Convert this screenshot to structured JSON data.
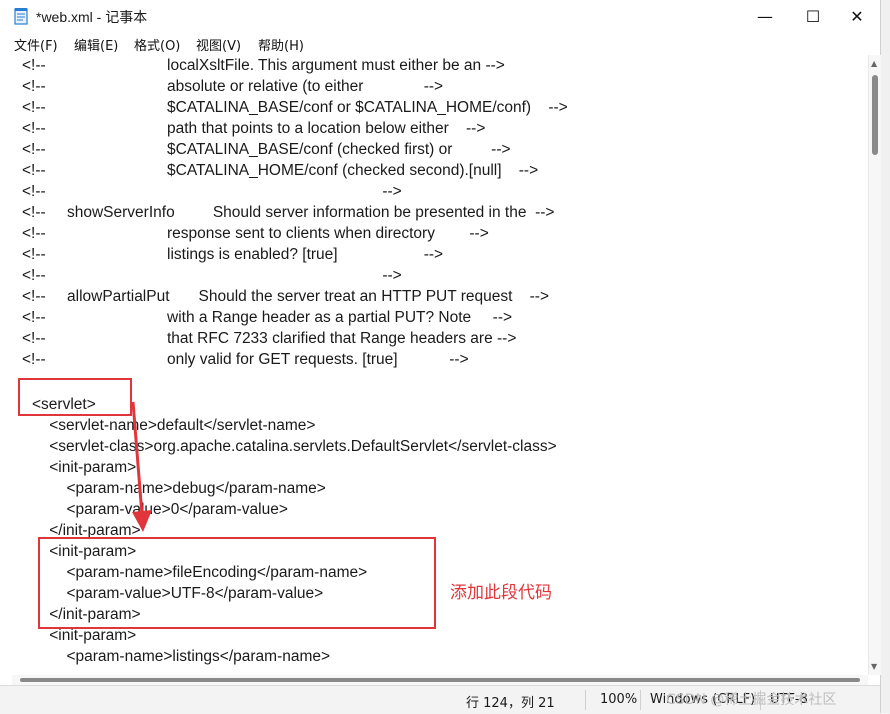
{
  "window": {
    "title": "*web.xml - 记事本",
    "controls": {
      "minimize": "—",
      "maximize": "☐",
      "close": "✕"
    }
  },
  "menu": [
    {
      "label": "文件(F)"
    },
    {
      "label": "编辑(E)"
    },
    {
      "label": "格式(O)"
    },
    {
      "label": "视图(V)"
    },
    {
      "label": "帮助(H)"
    }
  ],
  "editor": {
    "lines": [
      {
        "a": "<!--",
        "b": "",
        "c": "localXsltFile. This argument must either be an -->"
      },
      {
        "a": "<!--",
        "b": "",
        "c": "absolute or relative (to either              -->"
      },
      {
        "a": "<!--",
        "b": "",
        "c": "$CATALINA_BASE/conf or $CATALINA_HOME/conf)    -->"
      },
      {
        "a": "<!--",
        "b": "",
        "c": "path that points to a location below either    -->"
      },
      {
        "a": "<!--",
        "b": "",
        "c": "$CATALINA_BASE/conf (checked first) or         -->"
      },
      {
        "a": "<!--",
        "b": "",
        "c": "$CATALINA_HOME/conf (checked second).[null]    -->"
      },
      {
        "a": "<!--",
        "b": "",
        "c": "                                                  -->"
      },
      {
        "a": "<!--",
        "b": "showServerInfo",
        "c": "      Should server information be presented in the  -->"
      },
      {
        "a": "<!--",
        "b": "",
        "c": "response sent to clients when directory        -->"
      },
      {
        "a": "<!--",
        "b": "",
        "c": "listings is enabled? [true]                    -->"
      },
      {
        "a": "<!--",
        "b": "",
        "c": "                                                  -->"
      },
      {
        "a": "<!--",
        "b": "allowPartialPut",
        "c": "     Should the server treat an HTTP PUT request    -->"
      },
      {
        "a": "<!--",
        "b": "",
        "c": "with a Range header as a partial PUT? Note     -->"
      },
      {
        "a": "<!--",
        "b": "",
        "c": "that RFC 7233 clarified that Range headers are -->"
      },
      {
        "a": "<!--",
        "b": "",
        "c": "only valid for GET requests. [true]            -->"
      }
    ],
    "code": [
      "",
      "<servlet>",
      "    <servlet-name>default</servlet-name>",
      "    <servlet-class>org.apache.catalina.servlets.DefaultServlet</servlet-class>",
      "    <init-param>",
      "        <param-name>debug</param-name>",
      "        <param-value>0</param-value>",
      "    </init-param>",
      "    <init-param>",
      "        <param-name>fileEncoding</param-name>",
      "        <param-value>UTF-8</param-value>",
      "    </init-param>",
      "    <init-param>",
      "        <param-name>listings</param-name>"
    ]
  },
  "annotation": {
    "text": "添加此段代码",
    "color": "#e0363b"
  },
  "status": {
    "position": "行 124，列 21",
    "zoom": "100%",
    "line_ending": "Windows (CRLF)",
    "encoding": "UTF-8"
  },
  "watermark": "CSDN @稀土掘金技术社区"
}
